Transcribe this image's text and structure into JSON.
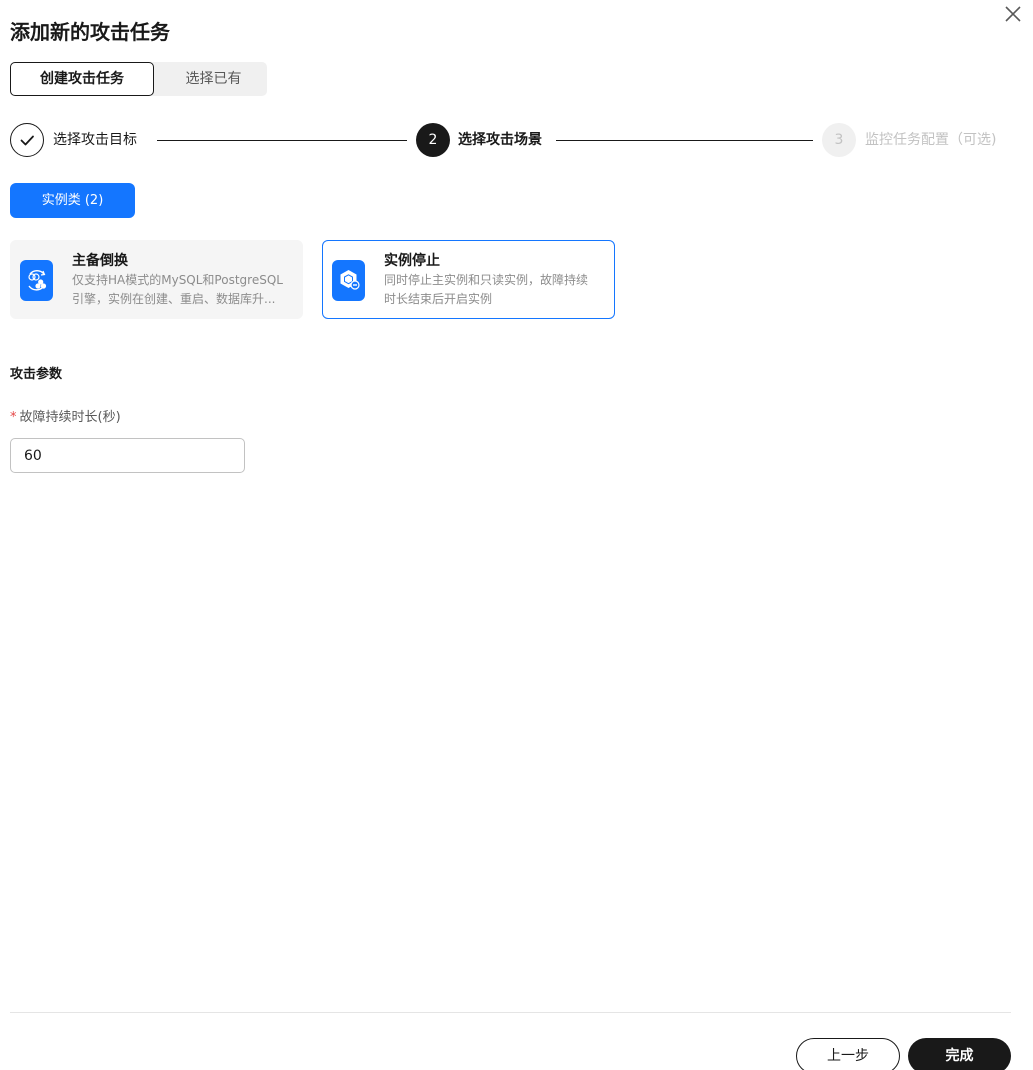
{
  "dialog": {
    "title": "添加新的攻击任务"
  },
  "mode_tabs": [
    {
      "label": "创建攻击任务",
      "active": true
    },
    {
      "label": "选择已有",
      "active": false
    }
  ],
  "steps": [
    {
      "label": "选择攻击目标",
      "state": "done",
      "number": ""
    },
    {
      "label": "选择攻击场景",
      "state": "current",
      "number": "2"
    },
    {
      "label": "监控任务配置（可选)",
      "state": "pending",
      "number": "3"
    }
  ],
  "category_button": {
    "label": "实例类 (2)"
  },
  "scenarios": [
    {
      "title": "主备倒换",
      "desc_lines": [
        "仅支持HA模式的MySQL和PostgreSQL",
        "引擎，实例在创建、重启、数据库升..."
      ],
      "selected": false
    },
    {
      "title": "实例停止",
      "desc_lines": [
        "同时停止主实例和只读实例，故障持续",
        "时长结束后开启实例"
      ],
      "selected": true
    }
  ],
  "params": {
    "section_title": "攻击参数",
    "duration_label": "故障持续时长(秒)",
    "required_mark": "*",
    "duration_value": "60"
  },
  "footer": {
    "prev_label": "上一步",
    "done_label": "完成"
  },
  "colors": {
    "accent": "#1476ff",
    "dark": "#191919",
    "required": "#e54545"
  }
}
